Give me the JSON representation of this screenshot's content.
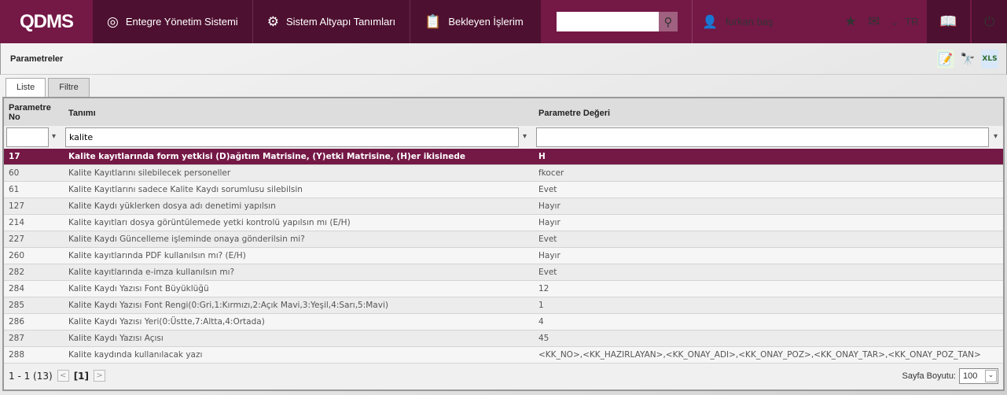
{
  "header": {
    "logo": "QDMS",
    "nav": [
      {
        "label": "Entegre Yönetim Sistemi",
        "icon": "q-icon"
      },
      {
        "label": "Sistem Altyapı Tanımları",
        "icon": "gear-icon"
      },
      {
        "label": "Bekleyen İşlerim",
        "icon": "clipboard-icon"
      }
    ],
    "search_value": "",
    "user": "furkan baş",
    "language": "TR"
  },
  "page": {
    "title": "Parametreler",
    "tabs": [
      "Liste",
      "Filtre"
    ]
  },
  "grid": {
    "columns": [
      "Parametre No",
      "Tanımı",
      "Parametre Değeri"
    ],
    "filters": {
      "no": "",
      "tanimi": "kalite",
      "deger": ""
    },
    "rows": [
      {
        "no": "17",
        "tanimi": "Kalite kayıtlarında form yetkisi (D)ağıtım Matrisine, (Y)etki Matrisine, (H)er ikisinede",
        "deger": "H"
      },
      {
        "no": "60",
        "tanimi": "Kalite Kayıtlarını silebilecek personeller",
        "deger": "fkocer"
      },
      {
        "no": "61",
        "tanimi": "Kalite Kayıtlarını sadece Kalite Kaydı sorumlusu silebilsin",
        "deger": "Evet"
      },
      {
        "no": "127",
        "tanimi": "Kalite Kaydı yüklerken dosya adı denetimi yapılsın",
        "deger": "Hayır"
      },
      {
        "no": "214",
        "tanimi": "Kalite kayıtları dosya görüntülemede yetki kontrolü yapılsın mı (E/H)",
        "deger": "Hayır"
      },
      {
        "no": "227",
        "tanimi": "Kalite Kaydı Güncelleme işleminde onaya gönderilsin mi?",
        "deger": "Evet"
      },
      {
        "no": "260",
        "tanimi": "Kalite kayıtlarında PDF kullanılsın mı? (E/H)",
        "deger": "Hayır"
      },
      {
        "no": "282",
        "tanimi": "Kalite kayıtlarında e-imza kullanılsın mı?",
        "deger": "Evet"
      },
      {
        "no": "284",
        "tanimi": "Kalite Kaydı Yazısı Font Büyüklüğü",
        "deger": "12"
      },
      {
        "no": "285",
        "tanimi": "Kalite Kaydı Yazısı Font Rengi(0:Gri,1:Kırmızı,2:Açık Mavi,3:Yeşil,4:Sarı,5:Mavi)",
        "deger": "1"
      },
      {
        "no": "286",
        "tanimi": "Kalite Kaydı Yazısı Yeri(0:Üstte,7:Altta,4:Ortada)",
        "deger": "4"
      },
      {
        "no": "287",
        "tanimi": "Kalite Kaydı Yazısı Açısı",
        "deger": "45"
      },
      {
        "no": "288",
        "tanimi": "Kalite kaydında kullanılacak yazı",
        "deger": "<KK_NO>,<KK_HAZIRLAYAN>,<KK_ONAY_ADI>,<KK_ONAY_POZ>,<KK_ONAY_TAR>,<KK_ONAY_POZ_TAN>"
      }
    ]
  },
  "pager": {
    "range": "1 - 1 (13)",
    "current": "[1]",
    "page_size_label": "Sayfa Boyutu:",
    "page_size": "100"
  }
}
